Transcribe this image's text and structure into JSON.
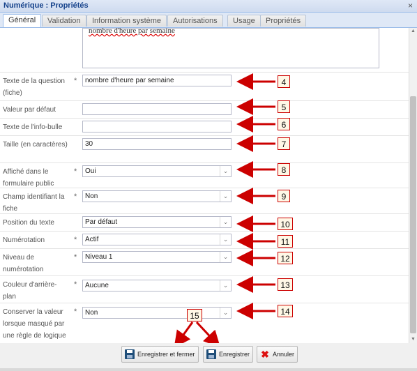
{
  "window": {
    "title": "Numérique : Propriétés",
    "close_glyph": "×"
  },
  "tabs": [
    {
      "label": "Général"
    },
    {
      "label": "Validation"
    },
    {
      "label": "Information système"
    },
    {
      "label": "Autorisations"
    },
    {
      "label": "Usage"
    },
    {
      "label": "Propriétés"
    }
  ],
  "description_text": "nombre d'heure par semaine",
  "required_mark": "*",
  "fields": {
    "question_label": "Texte de la question (fiche)",
    "question_value": "nombre d'heure par semaine",
    "default_label": "Valeur par défaut",
    "default_value": "",
    "tooltip_label": "Texte de l'info-bulle",
    "tooltip_value": "",
    "size_label": "Taille (en caractères)",
    "size_value": "30",
    "public_label": "Affiché dans le formulaire public",
    "public_value": "Oui",
    "identifier_label": "Champ identifiant la fiche",
    "identifier_value": "Non",
    "position_label": "Position du texte",
    "position_value": "Par défaut",
    "numbering_label": "Numérotation",
    "numbering_value": "Actif",
    "level_label": "Niveau de numérotation",
    "level_value": "Niveau 1",
    "bgcolor_label": "Couleur d'arrière-plan",
    "bgcolor_value": "Aucune",
    "keep_label": "Conserver la valeur lorsque masqué par une règle de logique",
    "keep_value": "Non"
  },
  "annotations": [
    "4",
    "5",
    "6",
    "7",
    "8",
    "9",
    "10",
    "11",
    "12",
    "13",
    "14",
    "15"
  ],
  "buttons": {
    "save_close": "Enregistrer et fermer",
    "save": "Enregistrer",
    "cancel": "Annuler"
  },
  "icons": {
    "dropdown": "chevron-down-icon",
    "save": "floppy-disk-icon",
    "cancel": "red-x-icon"
  },
  "colors": {
    "annotation_red": "#cc0000",
    "titlebar": "#15428b",
    "save_icon": "#1f4e79"
  }
}
